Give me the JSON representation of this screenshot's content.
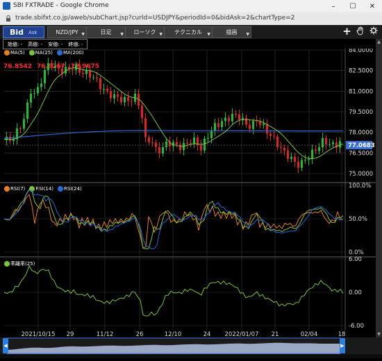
{
  "window": {
    "title": "SBI FXTRADE - Google Chrome",
    "url": "trade.sbifxt.co.jp/aweb/subChart.jsp?curId=USDJPY&periodId=0&bidAsk=2&chartType=2"
  },
  "toolbar": {
    "bid_label": "Bid",
    "ask_label": "Ask",
    "pair": "NZD/JPY",
    "period": "日足",
    "chart_type": "ローソク",
    "technical": "テクニカル",
    "draw": "描画"
  },
  "ohlc": {
    "open": "始値: -",
    "high": "高値: -",
    "low": "安値: -",
    "close": "終値: -"
  },
  "ma_legend": [
    {
      "name": "MA(5)",
      "color": "#e8801e"
    },
    {
      "name": "MA(25)",
      "color": "#7cc43a"
    },
    {
      "name": "MA(200)",
      "color": "#2b6ad3"
    }
  ],
  "ma_values": [
    "76.8542",
    "76.6267",
    "77.9675"
  ],
  "price_axis": [
    "84.0000",
    "82.5000",
    "81.0000",
    "79.5000",
    "78.0000",
    "76.5000",
    "75.0000"
  ],
  "current_price": "77.0683",
  "rsi_legend": [
    {
      "name": "RSI(7)",
      "color": "#e8801e"
    },
    {
      "name": "RSI(14)",
      "color": "#7cc43a"
    },
    {
      "name": "RSI(24)",
      "color": "#2b6ad3"
    }
  ],
  "rsi_axis": [
    "100.0%",
    "50.0%",
    "0.0%"
  ],
  "dev_legend": {
    "name": "乖離率(25)",
    "color": "#7cc43a"
  },
  "dev_axis": [
    "6.00",
    "0.00",
    "-6.00"
  ],
  "date_axis": [
    "2021/10/15",
    "29",
    "11/12",
    "26",
    "12/10",
    "24",
    "2022/01/07",
    "21",
    "02/04",
    "18"
  ],
  "colors": {
    "up": "#1fbf2c",
    "down": "#e02222",
    "grid": "#3a3a3a",
    "ma5": "#e8801e",
    "ma25": "#7cc43a",
    "ma200": "#2b6ad3",
    "price_tag": "#3a6fd8"
  }
}
